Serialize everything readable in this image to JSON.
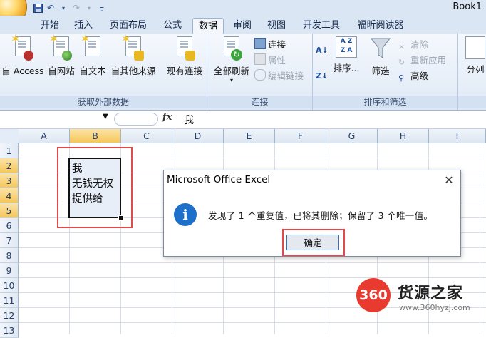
{
  "window": {
    "title": "Book1"
  },
  "tabs": [
    "开始",
    "插入",
    "页面布局",
    "公式",
    "数据",
    "审阅",
    "视图",
    "开发工具",
    "福昕阅读器"
  ],
  "active_tab": "数据",
  "ribbon": {
    "groups": {
      "external": {
        "label": "获取外部数据",
        "buttons": [
          "自 Access",
          "自网站",
          "自文本",
          "自其他来源",
          "现有连接"
        ]
      },
      "connections": {
        "label": "连接",
        "refresh": "全部刷新",
        "connect": "连接",
        "properties": "属性",
        "edit_links": "编辑链接"
      },
      "sort_filter": {
        "label": "排序和筛选",
        "sort": "排序...",
        "filter": "筛选",
        "clear": "清除",
        "reapply": "重新应用",
        "advanced": "高级"
      },
      "tools": {
        "split": "分列"
      }
    }
  },
  "formula_bar": {
    "fx": "fx",
    "content": "我"
  },
  "columns": [
    "A",
    "B",
    "C",
    "D",
    "E",
    "F",
    "G",
    "H",
    "I"
  ],
  "selected_column": "B",
  "rows": [
    "1",
    "2",
    "3",
    "4",
    "5",
    "6",
    "7",
    "8",
    "9",
    "10",
    "11",
    "12",
    "13"
  ],
  "selected_rows": [
    "2",
    "3",
    "4",
    "5"
  ],
  "cells": {
    "B2": "我",
    "B3": "无钱无权",
    "B4": "提供给"
  },
  "dialog": {
    "title": "Microsoft Office Excel",
    "close": "✕",
    "info_icon": "i",
    "message": "发现了 1 个重复值，已将其删除；保留了 3 个唯一值。",
    "ok": "确定"
  },
  "watermark": {
    "badge": "360",
    "title": "货源之家",
    "url": "www.360hyzj.com"
  },
  "colors": {
    "accent": "#1e6fc9",
    "highlight": "#e04a4a",
    "ribbon": "#dfe9f6"
  }
}
